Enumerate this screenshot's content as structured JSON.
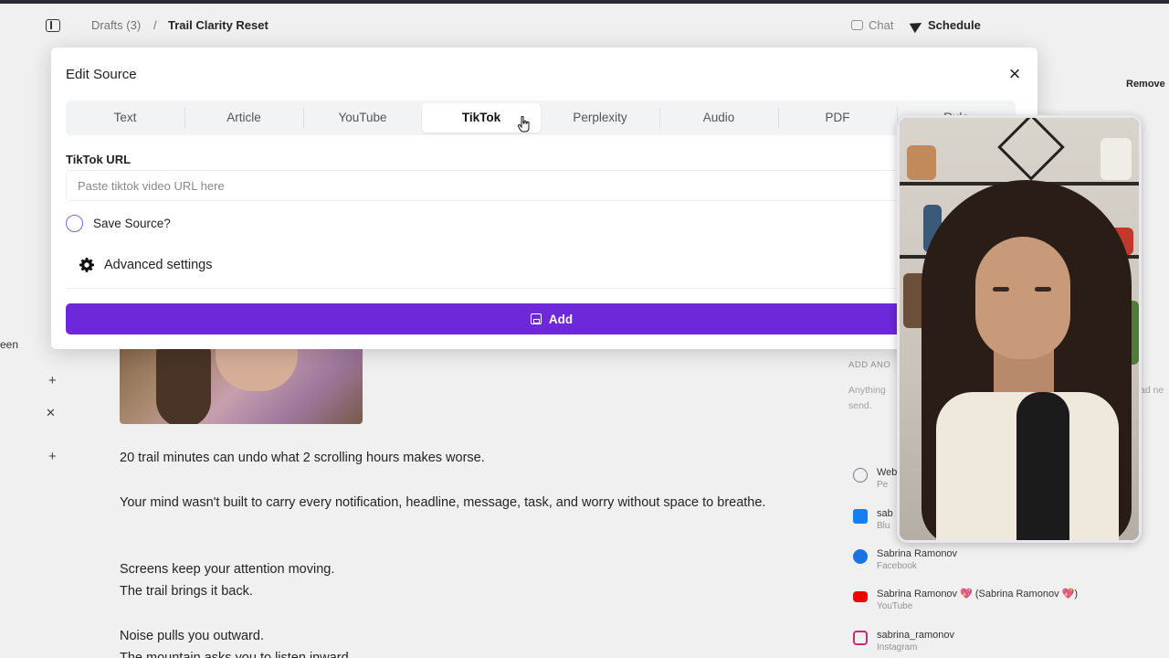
{
  "topbar": {
    "breadcrumb_drafts": "Drafts (3)",
    "breadcrumb_sep": "/",
    "breadcrumb_current": "Trail Clarity Reset",
    "chat_label": "Chat",
    "schedule_label": "Schedule"
  },
  "background": {
    "left_edge_text": "een",
    "post_lines": [
      "20 trail minutes can undo what 2 scrolling hours makes worse.",
      "Your mind wasn't built to carry every notification, headline, message, task, and worry without space to breathe.",
      "Screens keep your attention moving.",
      "The trail brings it back.",
      "Noise pulls you outward.",
      "The mountain asks you to listen inward."
    ],
    "right_panel": {
      "remove_label": "Remove",
      "add_another_label": "ADD ANO",
      "anything_text": "Anything send.",
      "anything_right_text": "ad ne",
      "accounts": [
        {
          "name": "Web",
          "platform": "Pe",
          "icon": "globe-icon",
          "color": "#7a7f8a"
        },
        {
          "name": "sab",
          "platform": "Blu",
          "icon": "bluesky-icon",
          "color": "#1185fe"
        },
        {
          "name": "Sabrina Ramonov",
          "platform": "Facebook",
          "icon": "facebook-icon",
          "color": "#1877f2"
        },
        {
          "name": "Sabrina Ramonov 💖 (Sabrina Ramonov 💖)",
          "platform": "YouTube",
          "icon": "youtube-icon",
          "color": "#ff0000"
        },
        {
          "name": "sabrina_ramonov",
          "platform": "Instagram",
          "icon": "instagram-icon",
          "color": "#d62976"
        }
      ]
    }
  },
  "modal": {
    "title": "Edit Source",
    "tabs": [
      {
        "label": "Text",
        "active": false
      },
      {
        "label": "Article",
        "active": false
      },
      {
        "label": "YouTube",
        "active": false
      },
      {
        "label": "TikTok",
        "active": true
      },
      {
        "label": "Perplexity",
        "active": false
      },
      {
        "label": "Audio",
        "active": false
      },
      {
        "label": "PDF",
        "active": false
      },
      {
        "label": "Rule",
        "active": false
      }
    ],
    "url_label": "TikTok URL",
    "url_value": "",
    "url_placeholder": "Paste tiktok video URL here",
    "save_source_label": "Save Source?",
    "save_source_checked": false,
    "advanced_settings_label": "Advanced settings",
    "add_button_label": "Add"
  },
  "colors": {
    "accent": "#6d28d9",
    "checkbox_border": "#7c62d9"
  }
}
